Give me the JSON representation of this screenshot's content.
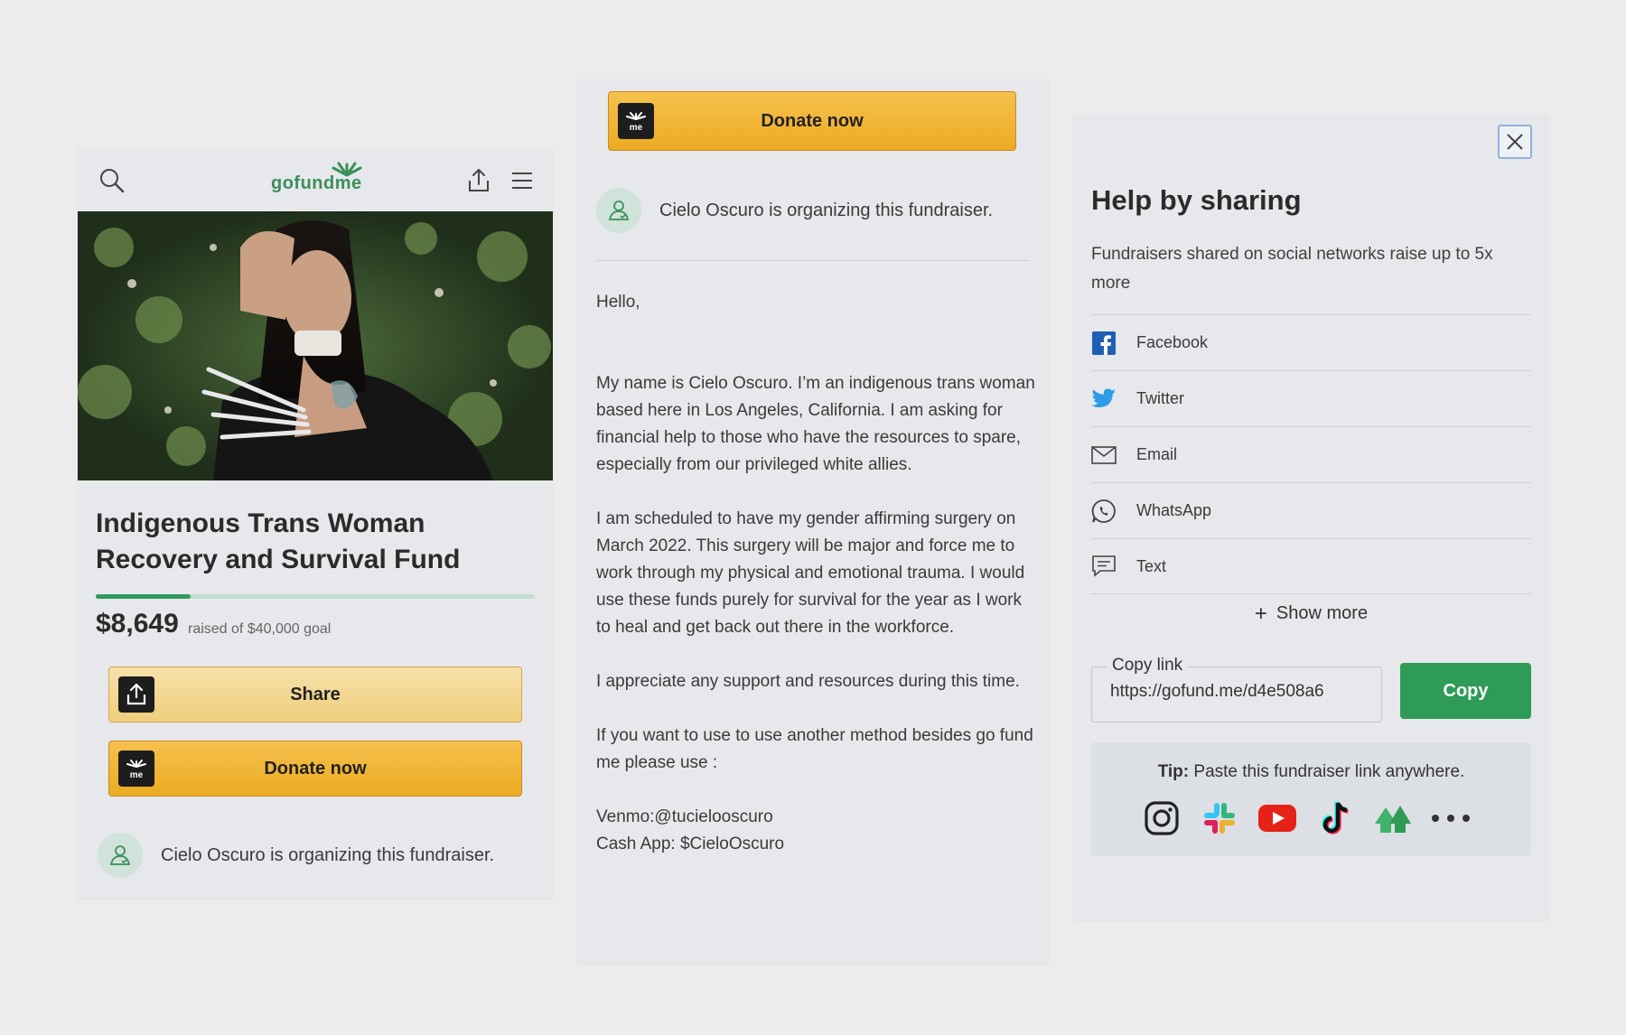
{
  "p1": {
    "logo_text": "gofundme",
    "title": "Indigenous Trans Woman Recovery and Survival Fund",
    "progress_fraction": 0.216,
    "amount": "$8,649",
    "goal_text": "raised of $40,000 goal",
    "share_label": "Share",
    "donate_label": "Donate now",
    "organizer": "Cielo Oscuro is organizing this fundraiser.",
    "icons": {
      "search": "search-icon",
      "share": "share-icon",
      "menu": "menu-icon"
    }
  },
  "p2": {
    "donate_label": "Donate now",
    "organizer": "Cielo Oscuro is organizing this fundraiser.",
    "story": {
      "greeting": "Hello,",
      "p1": "My name is Cielo Oscuro. I’m an indigenous trans woman based here in Los Angeles, California. I am asking for financial help to those who have the resources to spare, especially from our privileged white allies.",
      "p2": "I am scheduled to have my gender affirming surgery on March 2022.  This surgery will be major and force me to work through my physical and emotional trauma. I would use these funds purely for survival for the year as I work to heal and get back out there in the workforce.",
      "p3": "I appreciate any  support  and resources during this time.",
      "p4": "If you want to use to use another method besides go fund me please use :",
      "venmo": "Venmo:@tucielooscuro",
      "cashapp": "Cash App: $CieloOscuro"
    }
  },
  "p3": {
    "heading": "Help by sharing",
    "subtitle": "Fundraisers shared on social networks raise up to 5x more",
    "options": [
      {
        "label": "Facebook",
        "icon": "facebook-icon"
      },
      {
        "label": "Twitter",
        "icon": "twitter-icon"
      },
      {
        "label": "Email",
        "icon": "email-icon"
      },
      {
        "label": "WhatsApp",
        "icon": "whatsapp-icon"
      },
      {
        "label": "Text",
        "icon": "text-message-icon"
      }
    ],
    "show_more": "Show more",
    "copy_legend": "Copy link",
    "copy_value": "https://gofund.me/d4e508a6",
    "copy_button": "Copy",
    "tip_bold": "Tip:",
    "tip_text": " Paste this fundraiser link anywhere.",
    "apps": [
      "instagram-icon",
      "slack-icon",
      "youtube-icon",
      "tiktok-icon",
      "nextdoor-icon",
      "more-icon"
    ]
  },
  "colors": {
    "brand_green": "#2e9b56",
    "donate_yellow": "#ecab23",
    "share_yellow": "#f0cf7d",
    "panel_bg": "#e6e8eb"
  }
}
